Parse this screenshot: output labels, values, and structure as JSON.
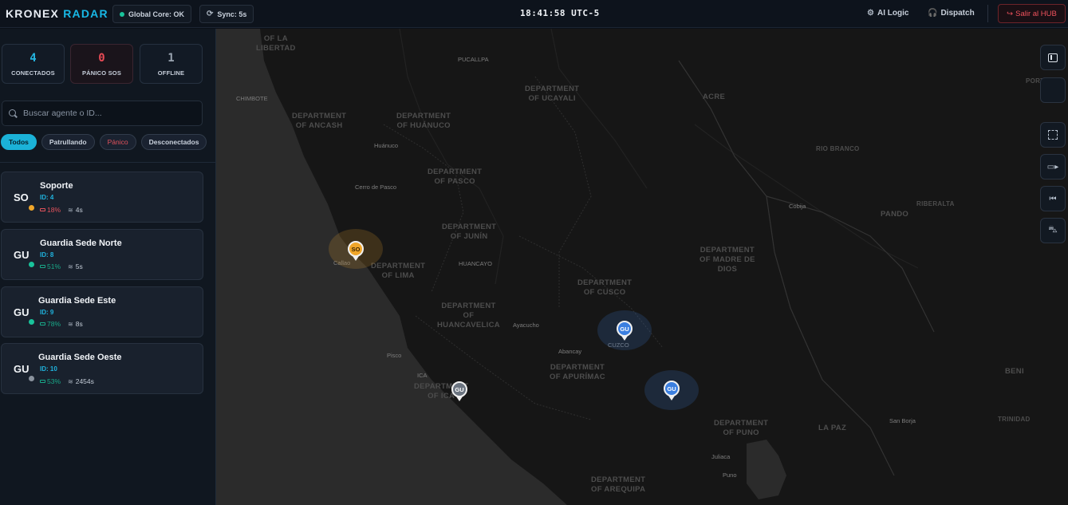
{
  "header": {
    "brand_part1": "KRONEX",
    "brand_part2": "RADAR",
    "core_status": "Global Core: OK",
    "sync_status": "Sync: 5s",
    "clock": "18:41:58 UTC-5",
    "ai_logic": "AI Logic",
    "dispatch": "Dispatch",
    "exit": "Salir al HUB"
  },
  "stats": [
    {
      "value": "4",
      "label": "CONECTADOS",
      "color": "#24b5e0"
    },
    {
      "value": "0",
      "label": "PÁNICO SOS",
      "color": "#e84a55"
    },
    {
      "value": "1",
      "label": "OFFLINE",
      "color": "#9aa4b1"
    }
  ],
  "search": {
    "placeholder": "Buscar agente o ID..."
  },
  "filters": [
    "Todos",
    "Patrullando",
    "Pánico",
    "Desconectados"
  ],
  "agents": [
    {
      "initials": "SO",
      "name": "Soporte",
      "id_text": "ID: 4",
      "battery": "18%",
      "signal": "4s",
      "status_color": "#f0a62a",
      "battery_color": "#e2525c"
    },
    {
      "initials": "GU",
      "name": "Guardia Sede Norte",
      "id_text": "ID: 8",
      "battery": "51%",
      "signal": "5s",
      "status_color": "#19c39b",
      "battery_color": "#19a989"
    },
    {
      "initials": "GU",
      "name": "Guardia Sede Este",
      "id_text": "ID: 9",
      "battery": "78%",
      "signal": "8s",
      "status_color": "#19c39b",
      "battery_color": "#19a989"
    },
    {
      "initials": "GU",
      "name": "Guardia Sede Oeste",
      "id_text": "ID: 10",
      "battery": "53%",
      "signal": "2454s",
      "status_color": "#8a929d",
      "battery_color": "#19a989"
    }
  ],
  "map": {
    "regions": [
      "OF LA\nLIBERTAD",
      "DEPARTMENT\nOF ANCASH",
      "DEPARTMENT\nOF HUÁNUCO",
      "DEPARTMENT\nOF UCAYALI",
      "ACRE",
      "DEPARTMENT\nOF PASCO",
      "DEPARTMENT\nOF JUNÍN",
      "DEPARTMENT\nOF LIMA",
      "DEPARTMENT\nOF MADRE DE\nDIOS",
      "DEPARTMENT\nOF CUSCO",
      "DEPARTMENT\nOF\nHUANCAVELICA",
      "DEPARTMENT\nOF APURÍMAC",
      "DEPARTMENT\nOF ICA",
      "DEPARTMENT\nOF PUNO",
      "LA PAZ",
      "DEPARTMENT\nOF AREQUIPA",
      "PANDO",
      "BENI",
      "RIBERALTA",
      "RIO BRANCO",
      "TRINIDAD",
      "PORT"
    ],
    "cities": [
      "PUCALLPA",
      "CHIMBOTE",
      "Huánuco",
      "Cerro de Pasco",
      "HUANCAYO",
      "Callao",
      "Ayacucho",
      "Abancay",
      "CUZCO",
      "Pisco",
      "ICA",
      "Juliaca",
      "Puno",
      "San Borja",
      "Cobija"
    ],
    "markers": [
      {
        "label": "SO",
        "color": "#f0a62a"
      },
      {
        "label": "GU",
        "color": "#3b7fe0"
      },
      {
        "label": "GU",
        "color": "#3b7fe0"
      },
      {
        "label": "GU",
        "color": "#6b7480"
      }
    ]
  },
  "map_controls": [
    "sidebar-toggle-icon",
    "blank",
    "fit-bounds-icon",
    "video-icon",
    "rewind-icon",
    "car-icon"
  ]
}
